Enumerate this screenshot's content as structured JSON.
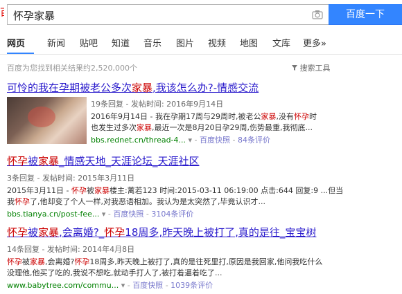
{
  "search": {
    "query": "怀孕家暴",
    "button": "百度一下"
  },
  "tabs": [
    "网页",
    "新闻",
    "贴吧",
    "知道",
    "音乐",
    "图片",
    "视频",
    "地图",
    "文库",
    "更多»"
  ],
  "stats": "百度为您找到相关结果约2,520,000个",
  "tools": "搜索工具",
  "results": [
    {
      "title_parts": [
        "可怜的我在孕期被老公多次",
        "家暴",
        ",我该怎么办?-情感交流"
      ],
      "meta": "19条回复 - 发帖时间: 2016年9月14日",
      "snippet1_parts": [
        "2016年9月14日 - 我在孕期17周与29周时,被老公",
        "家暴",
        ",没有",
        "怀孕",
        "时"
      ],
      "snippet2_parts": [
        "也发生过多次",
        "家暴",
        ",最近一次是8月20日孕29周,伤势最重,我彻底..."
      ],
      "url": "bbs.rednet.cn/thread-4...",
      "snapshot": "百度快照",
      "reviews": "84条评价"
    },
    {
      "title_parts": [
        "怀孕",
        "被",
        "家暴",
        "_情感天地_天涯论坛_天涯社区"
      ],
      "meta": "3条回复 - 发帖时间: 2015年3月11日",
      "snippet1_parts": [
        "2015年3月11日 - ",
        "怀孕",
        "被",
        "家暴",
        "楼主:蓠若123 时间:2015-03-11 06:19:00 点击:644 回复:9 ...但当"
      ],
      "snippet2_parts": [
        "我",
        "怀孕",
        "了,他却变了个人一样,对我恶语相加。我认为是太突然了,毕竟认识才..."
      ],
      "url": "bbs.tianya.cn/post-fee...",
      "snapshot": "百度快照",
      "reviews": "3104条评价"
    },
    {
      "title_parts": [
        "怀孕",
        "被",
        "家暴",
        ",会离婚?_",
        "怀孕",
        "18周多,昨天晚上被打了,真的是往_宝宝树"
      ],
      "meta": "14条回复 - 发帖时间: 2014年4月8日",
      "snippet1_parts": [
        "怀孕",
        "被",
        "家暴",
        ",会离婚?",
        "怀孕",
        "18周多,昨天晚上被打了,真的是往死里打,原因是我回家,他问我吃什么"
      ],
      "snippet2_parts": [
        "没理他,他买了吃的,我说不想吃,就动手打人了,被打着逼着吃了..."
      ],
      "url": "www.babytree.com/commu...",
      "snapshot": "百度快照",
      "reviews": "1039条评价"
    }
  ],
  "colors": {
    "link": "#2a1bcc",
    "highlight": "#c00",
    "url": "#008000",
    "brand": "#3385ff"
  }
}
